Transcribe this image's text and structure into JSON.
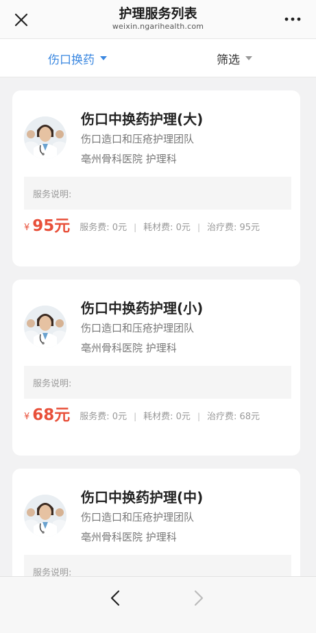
{
  "header": {
    "title": "护理服务列表",
    "subtitle": "weixin.ngarihealth.com"
  },
  "filters": {
    "category": "伤口换药",
    "filter": "筛选"
  },
  "services": [
    {
      "title": "伤口中换药护理(大)",
      "team": "伤口造口和压疮护理团队",
      "dept": "亳州骨科医院 护理科",
      "desc_label": "服务说明:",
      "currency": "¥",
      "amount": "95元",
      "fees": "服务费: 0元",
      "materials": "耗材费: 0元",
      "treatment": "治疗费: 95元"
    },
    {
      "title": "伤口中换药护理(小)",
      "team": "伤口造口和压疮护理团队",
      "dept": "亳州骨科医院 护理科",
      "desc_label": "服务说明:",
      "currency": "¥",
      "amount": "68元",
      "fees": "服务费: 0元",
      "materials": "耗材费: 0元",
      "treatment": "治疗费: 68元"
    },
    {
      "title": "伤口中换药护理(中)",
      "team": "伤口造口和压疮护理团队",
      "dept": "亳州骨科医院 护理科",
      "desc_label": "服务说明:"
    }
  ],
  "icons": {
    "close": "close-icon",
    "more": "more-icon",
    "back": "chevron-left-icon",
    "forward": "chevron-right-icon"
  },
  "colors": {
    "accent": "#3a87e0",
    "price": "#e8503a"
  }
}
